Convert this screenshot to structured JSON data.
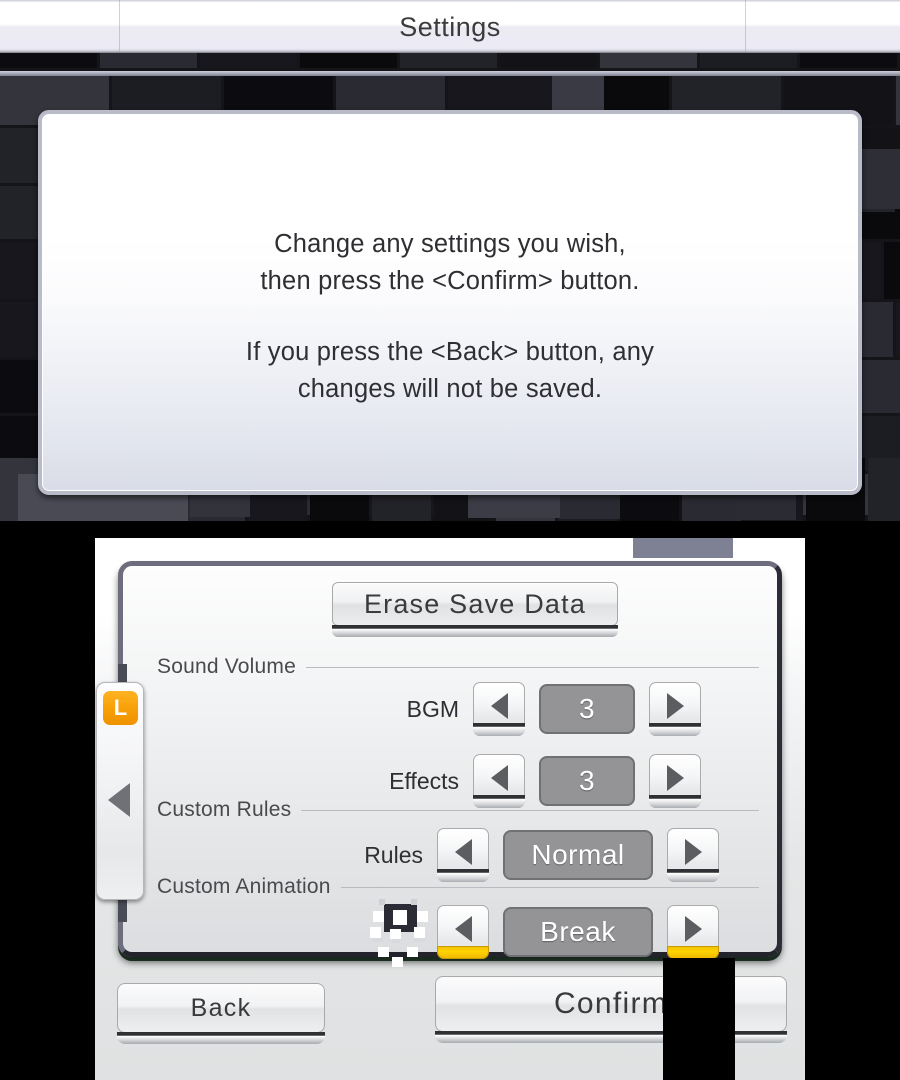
{
  "window": {
    "title": "Settings"
  },
  "top_screen": {
    "dialog": {
      "line1": "Change any settings you wish,",
      "line2": "then press the <Confirm> button.",
      "line3": "If you press the <Back> button, any",
      "line4": "changes will not be saved."
    }
  },
  "bottom_screen": {
    "erase_button": {
      "label": "Erase Save Data"
    },
    "sections": [
      {
        "label": "Sound Volume"
      },
      {
        "label": "Custom Rules"
      },
      {
        "label": "Custom Animation"
      }
    ],
    "settings": [
      {
        "label": "BGM",
        "value": "3",
        "highlighted": false
      },
      {
        "label": "Effects",
        "value": "3",
        "highlighted": false
      },
      {
        "label": "Rules",
        "value": "Normal",
        "highlighted": false
      },
      {
        "label": "",
        "value": "Break",
        "highlighted": true
      }
    ],
    "buttons": {
      "back": "Back",
      "confirm": "Confirm"
    },
    "side_tab": {
      "badge": "L"
    }
  },
  "colors": {
    "accent_yellow": "#f3c200",
    "badge_orange": "#f79f06",
    "panel_border": "#6d6d7d",
    "value_box": "#949497",
    "title_bar": "#ecebf4"
  }
}
